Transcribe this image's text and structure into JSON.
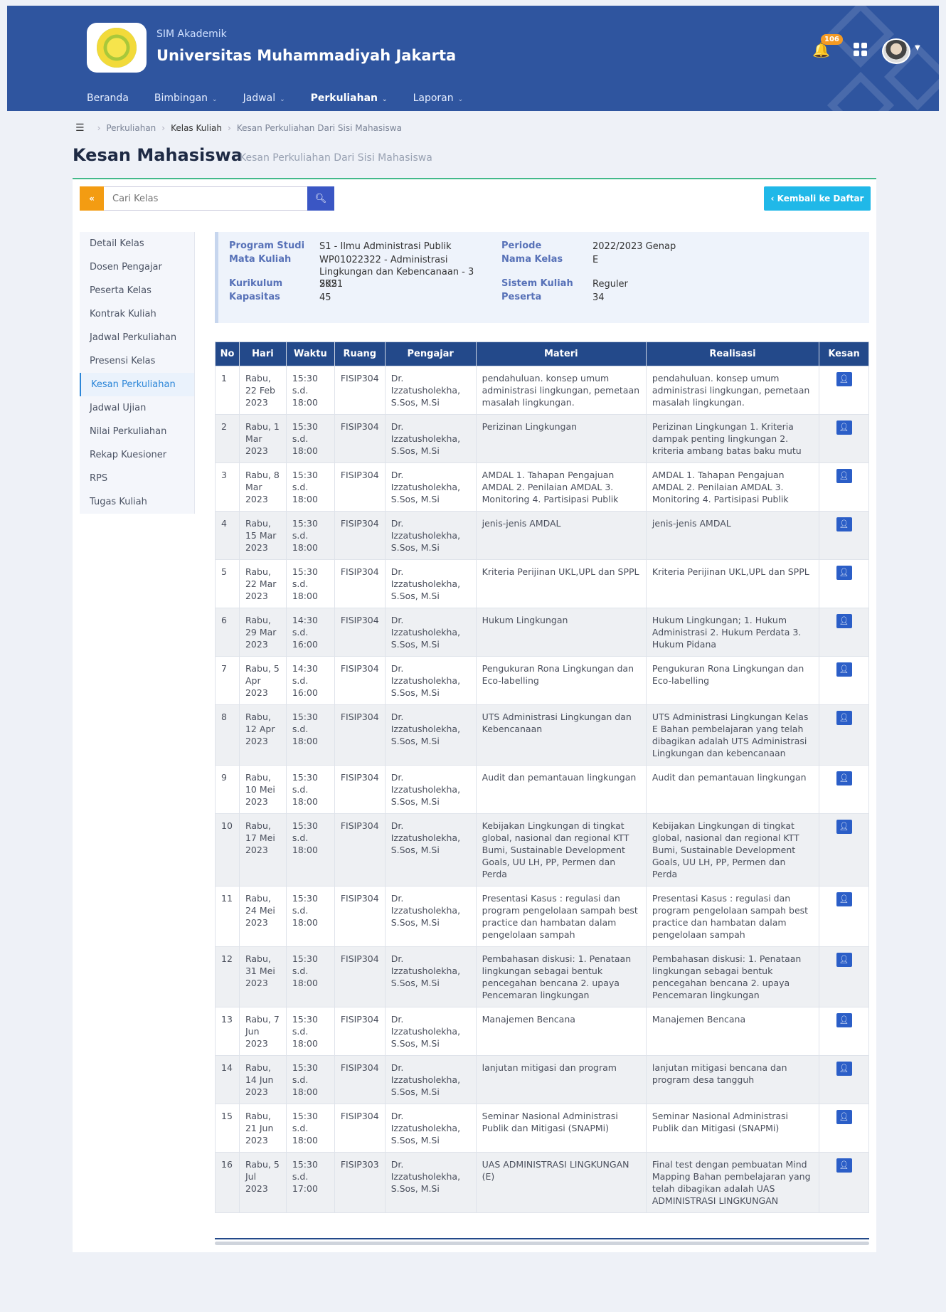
{
  "header": {
    "subtitle": "SIM Akademik",
    "title": "Universitas Muhammadiyah Jakarta",
    "notif_count": "106"
  },
  "nav": [
    {
      "label": "Beranda",
      "dropdown": false
    },
    {
      "label": "Bimbingan",
      "dropdown": true
    },
    {
      "label": "Jadwal",
      "dropdown": true
    },
    {
      "label": "Perkuliahan",
      "dropdown": true,
      "active": true
    },
    {
      "label": "Laporan",
      "dropdown": true
    }
  ],
  "breadcrumb": {
    "item1": "Perkuliahan",
    "item2": "Kelas Kuliah",
    "item3": "Kesan Perkuliahan Dari Sisi Mahasiswa"
  },
  "page": {
    "title": "Kesan Mahasiswa",
    "subtitle": "Kesan Perkuliahan Dari Sisi Mahasiswa"
  },
  "search": {
    "collapse_label": "«",
    "placeholder": "Cari Kelas"
  },
  "back_button": "‹ Kembali ke Daftar",
  "sidebar": [
    "Detail Kelas",
    "Dosen Pengajar",
    "Peserta Kelas",
    "Kontrak Kuliah",
    "Jadwal Perkuliahan",
    "Presensi Kelas",
    "Kesan Perkuliahan",
    "Jadwal Ujian",
    "Nilai Perkuliahan",
    "Rekap Kuesioner",
    "RPS",
    "Tugas Kuliah"
  ],
  "sidebar_active": "Kesan Perkuliahan",
  "info": {
    "program_studi_label": "Program Studi",
    "program_studi": "S1 - Ilmu Administrasi Publik",
    "mata_kuliah_label": "Mata Kuliah",
    "mata_kuliah": "WP01022322 - Administrasi Lingkungan dan Kebencanaan - 3 SKS",
    "kurikulum_label": "Kurikulum",
    "kurikulum": "2021",
    "kapasitas_label": "Kapasitas",
    "kapasitas": "45",
    "periode_label": "Periode",
    "periode": "2022/2023 Genap",
    "nama_kelas_label": "Nama Kelas",
    "nama_kelas": "E",
    "sistem_kuliah_label": "Sistem Kuliah",
    "sistem_kuliah": "Reguler",
    "peserta_label": "Peserta",
    "peserta": "34"
  },
  "table": {
    "headers": [
      "No",
      "Hari",
      "Waktu",
      "Ruang",
      "Pengajar",
      "Materi",
      "Realisasi",
      "Kesan"
    ],
    "rows": [
      {
        "no": "1",
        "hari": "Rabu, 22 Feb 2023",
        "waktu": "15:30 s.d. 18:00",
        "ruang": "FISIP304",
        "pengajar": "Dr. Izzatusholekha, S.Sos, M.Si",
        "materi": "pendahuluan. konsep umum administrasi lingkungan, pemetaan masalah lingkungan.",
        "realisasi": "pendahuluan. konsep umum administrasi lingkungan, pemetaan masalah lingkungan."
      },
      {
        "no": "2",
        "hari": "Rabu, 1 Mar 2023",
        "waktu": "15:30 s.d. 18:00",
        "ruang": "FISIP304",
        "pengajar": "Dr. Izzatusholekha, S.Sos, M.Si",
        "materi": "Perizinan Lingkungan",
        "realisasi": "Perizinan Lingkungan 1. Kriteria dampak penting lingkungan 2. kriteria ambang batas baku mutu"
      },
      {
        "no": "3",
        "hari": "Rabu, 8 Mar 2023",
        "waktu": "15:30 s.d. 18:00",
        "ruang": "FISIP304",
        "pengajar": "Dr. Izzatusholekha, S.Sos, M.Si",
        "materi": "AMDAL 1. Tahapan Pengajuan AMDAL 2. Penilaian AMDAL 3. Monitoring 4. Partisipasi Publik",
        "realisasi": "AMDAL 1. Tahapan Pengajuan AMDAL 2. Penilaian AMDAL 3. Monitoring 4. Partisipasi Publik"
      },
      {
        "no": "4",
        "hari": "Rabu, 15 Mar 2023",
        "waktu": "15:30 s.d. 18:00",
        "ruang": "FISIP304",
        "pengajar": "Dr. Izzatusholekha, S.Sos, M.Si",
        "materi": "jenis-jenis AMDAL",
        "realisasi": "jenis-jenis AMDAL"
      },
      {
        "no": "5",
        "hari": "Rabu, 22 Mar 2023",
        "waktu": "15:30 s.d. 18:00",
        "ruang": "FISIP304",
        "pengajar": "Dr. Izzatusholekha, S.Sos, M.Si",
        "materi": "Kriteria Perijinan UKL,UPL dan SPPL",
        "realisasi": "Kriteria Perijinan UKL,UPL dan SPPL"
      },
      {
        "no": "6",
        "hari": "Rabu, 29 Mar 2023",
        "waktu": "14:30 s.d. 16:00",
        "ruang": "FISIP304",
        "pengajar": "Dr. Izzatusholekha, S.Sos, M.Si",
        "materi": "Hukum Lingkungan",
        "realisasi": "Hukum Lingkungan; 1. Hukum Administrasi 2. Hukum Perdata 3. Hukum Pidana"
      },
      {
        "no": "7",
        "hari": "Rabu, 5 Apr 2023",
        "waktu": "14:30 s.d. 16:00",
        "ruang": "FISIP304",
        "pengajar": "Dr. Izzatusholekha, S.Sos, M.Si",
        "materi": "Pengukuran Rona Lingkungan dan Eco-labelling",
        "realisasi": "Pengukuran Rona Lingkungan dan Eco-labelling"
      },
      {
        "no": "8",
        "hari": "Rabu, 12 Apr 2023",
        "waktu": "15:30 s.d. 18:00",
        "ruang": "FISIP304",
        "pengajar": "Dr. Izzatusholekha, S.Sos, M.Si",
        "materi": "UTS Administrasi Lingkungan dan Kebencanaan",
        "realisasi": "UTS Administrasi Lingkungan Kelas E Bahan pembelajaran yang telah dibagikan adalah UTS Administrasi Lingkungan dan kebencanaan"
      },
      {
        "no": "9",
        "hari": "Rabu, 10 Mei 2023",
        "waktu": "15:30 s.d. 18:00",
        "ruang": "FISIP304",
        "pengajar": "Dr. Izzatusholekha, S.Sos, M.Si",
        "materi": "Audit dan pemantauan lingkungan",
        "realisasi": "Audit dan pemantauan lingkungan"
      },
      {
        "no": "10",
        "hari": "Rabu, 17 Mei 2023",
        "waktu": "15:30 s.d. 18:00",
        "ruang": "FISIP304",
        "pengajar": "Dr. Izzatusholekha, S.Sos, M.Si",
        "materi": "Kebijakan Lingkungan di tingkat global, nasional dan regional KTT Bumi, Sustainable Development Goals, UU LH, PP, Permen dan Perda",
        "realisasi": "Kebijakan Lingkungan di tingkat global, nasional dan regional KTT Bumi, Sustainable Development Goals, UU LH, PP, Permen dan Perda"
      },
      {
        "no": "11",
        "hari": "Rabu, 24 Mei 2023",
        "waktu": "15:30 s.d. 18:00",
        "ruang": "FISIP304",
        "pengajar": "Dr. Izzatusholekha, S.Sos, M.Si",
        "materi": "Presentasi Kasus : regulasi dan program pengelolaan sampah best practice dan hambatan dalam pengelolaan sampah",
        "realisasi": "Presentasi Kasus : regulasi dan program pengelolaan sampah best practice dan hambatan dalam pengelolaan sampah"
      },
      {
        "no": "12",
        "hari": "Rabu, 31 Mei 2023",
        "waktu": "15:30 s.d. 18:00",
        "ruang": "FISIP304",
        "pengajar": "Dr. Izzatusholekha, S.Sos, M.Si",
        "materi": "Pembahasan diskusi: 1. Penataan lingkungan sebagai bentuk pencegahan bencana 2. upaya Pencemaran lingkungan",
        "realisasi": "Pembahasan diskusi: 1. Penataan lingkungan sebagai bentuk pencegahan bencana 2. upaya Pencemaran lingkungan"
      },
      {
        "no": "13",
        "hari": "Rabu, 7 Jun 2023",
        "waktu": "15:30 s.d. 18:00",
        "ruang": "FISIP304",
        "pengajar": "Dr. Izzatusholekha, S.Sos, M.Si",
        "materi": "Manajemen Bencana",
        "realisasi": "Manajemen Bencana"
      },
      {
        "no": "14",
        "hari": "Rabu, 14 Jun 2023",
        "waktu": "15:30 s.d. 18:00",
        "ruang": "FISIP304",
        "pengajar": "Dr. Izzatusholekha, S.Sos, M.Si",
        "materi": "lanjutan mitigasi dan program",
        "realisasi": "lanjutan mitigasi bencana dan program desa tangguh"
      },
      {
        "no": "15",
        "hari": "Rabu, 21 Jun 2023",
        "waktu": "15:30 s.d. 18:00",
        "ruang": "FISIP304",
        "pengajar": "Dr. Izzatusholekha, S.Sos, M.Si",
        "materi": "Seminar Nasional Administrasi Publik dan Mitigasi (SNAPMi)",
        "realisasi": "Seminar Nasional Administrasi Publik dan Mitigasi (SNAPMi)"
      },
      {
        "no": "16",
        "hari": "Rabu, 5 Jul 2023",
        "waktu": "15:30 s.d. 17:00",
        "ruang": "FISIP303",
        "pengajar": "Dr. Izzatusholekha, S.Sos, M.Si",
        "materi": "UAS ADMINISTRASI LINGKUNGAN (E)",
        "realisasi": "Final test dengan pembuatan Mind Mapping Bahan pembelajaran yang telah dibagikan adalah UAS ADMINISTRASI LINGKUNGAN"
      }
    ]
  },
  "colors": {
    "header_bg": "#2f559f",
    "table_header_bg": "#23498a",
    "accent_green": "#43b98a",
    "back_button": "#20b8e8",
    "collapse_button": "#f39c12"
  }
}
